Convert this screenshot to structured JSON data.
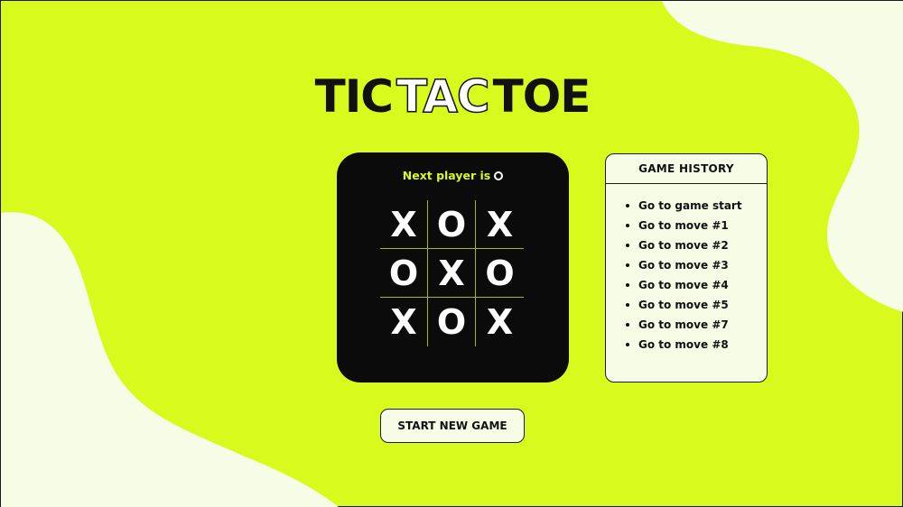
{
  "title": {
    "part1": "TIC",
    "part2": "TAC",
    "part3": "TOE"
  },
  "status": {
    "label": "Next player is",
    "next_symbol": "O"
  },
  "board": [
    "X",
    "O",
    "X",
    "O",
    "X",
    "O",
    "X",
    "O",
    "X"
  ],
  "history": {
    "title": "GAME HISTORY",
    "items": [
      "Go to game start",
      "Go to move #1",
      "Go to move #2",
      "Go to move #3",
      "Go to move #4",
      "Go to move #5",
      "Go to move #7",
      "Go to move #8"
    ]
  },
  "actions": {
    "start_new_game": "START NEW GAME"
  },
  "colors": {
    "background": "#d8fb1d",
    "accent": "#d8fb1d",
    "card": "#0b0b0b",
    "panel": "#f7fce6"
  }
}
